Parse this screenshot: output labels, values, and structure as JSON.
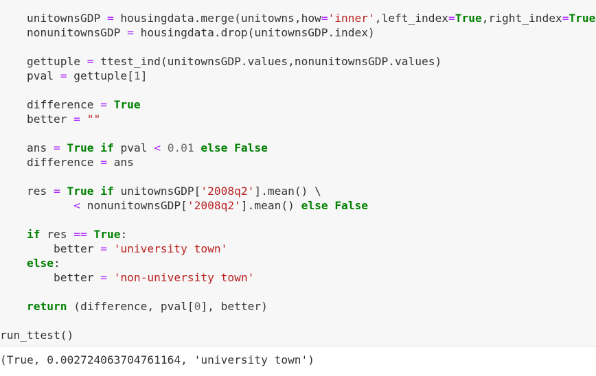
{
  "code_cell": {
    "lines": [
      {
        "id": "l1",
        "text": "    unitownsGDP = housingdata.merge(unitowns,how='inner',left_index=True,right_index=True)"
      },
      {
        "id": "l2",
        "text": "    nonunitownsGDP = housingdata.drop(unitownsGDP.index)"
      },
      {
        "id": "l3",
        "text": "    gettuple = ttest_ind(unitownsGDP.values,nonunitownsGDP.values)"
      },
      {
        "id": "l4",
        "text": "    pval = gettuple[1]"
      },
      {
        "id": "l5",
        "text": "    difference = True"
      },
      {
        "id": "l6",
        "text": "    better = \"\""
      },
      {
        "id": "l7",
        "text": "    ans = True if pval < 0.01 else False"
      },
      {
        "id": "l8",
        "text": "    difference = ans"
      },
      {
        "id": "l9",
        "text": "    res = True if unitownsGDP['2008q2'].mean() \\"
      },
      {
        "id": "l10",
        "text": "           < nonunitownsGDP['2008q2'].mean() else False"
      },
      {
        "id": "l11",
        "text": "    if res == True:"
      },
      {
        "id": "l12",
        "text": "        better = 'university town'"
      },
      {
        "id": "l13",
        "text": "    else:"
      },
      {
        "id": "l14",
        "text": "        better = 'non-university town'"
      },
      {
        "id": "l15",
        "text": "    return (difference, pval[0], better)"
      },
      {
        "id": "l16",
        "text": "run_ttest()"
      }
    ]
  },
  "output_cell": {
    "text": "(True, 0.002724063704761164, 'university town')"
  },
  "colors": {
    "cell_bg": "#f7f7f7",
    "keyword": "#008000",
    "operator": "#aa22ff",
    "string": "#ba2121",
    "number": "#666666",
    "text": "#333333"
  }
}
